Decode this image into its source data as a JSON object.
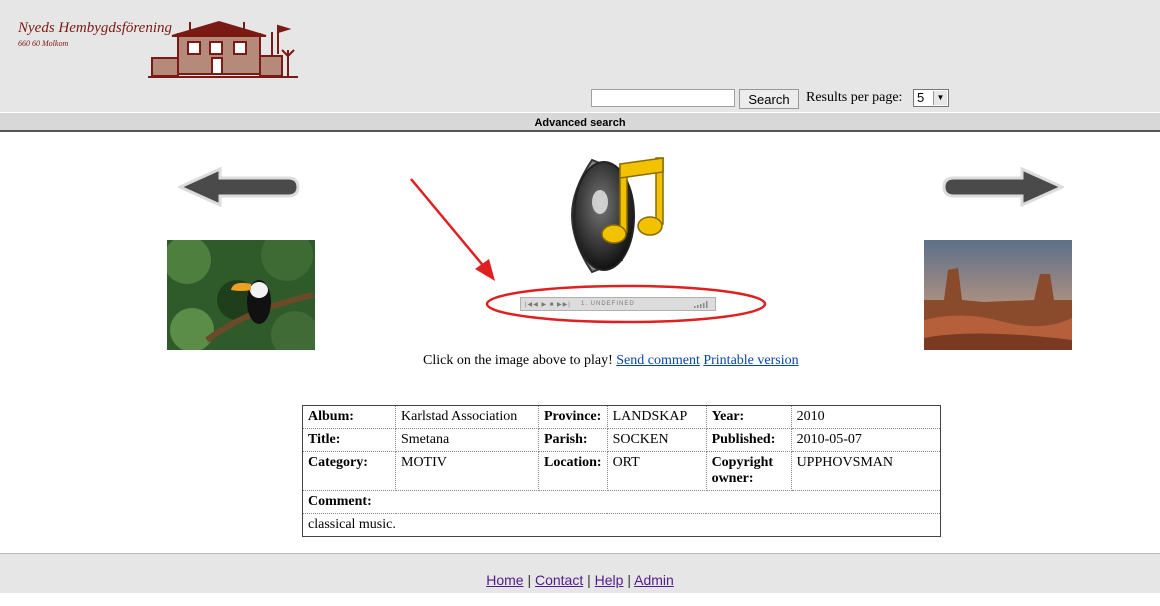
{
  "logo": {
    "name": "Nyeds Hembygdsförening",
    "address": "660 60 Molkom"
  },
  "search": {
    "button_label": "Search",
    "results_label": "Results per page:",
    "results_value": "5"
  },
  "advanced_search": "Advanced search",
  "player": {
    "track": "1. UNDEFINED"
  },
  "instructions": {
    "text": "Click on the image above to play!",
    "send_comment": "Send comment",
    "printable": "Printable version"
  },
  "details": {
    "album_label": "Album:",
    "album": "Karlstad Association",
    "province_label": "Province:",
    "province": "LANDSKAP",
    "year_label": "Year:",
    "year": "2010",
    "title_label": "Title:",
    "title": "Smetana",
    "parish_label": "Parish:",
    "parish": "SOCKEN",
    "published_label": "Published:",
    "published": "2010-05-07",
    "category_label": "Category:",
    "category": "MOTIV",
    "location_label": "Location:",
    "location": "ORT",
    "copyright_label": "Copyright owner:",
    "copyright": "UPPHOVSMAN",
    "comment_label": "Comment:",
    "comment": "classical music."
  },
  "footer": {
    "home": "Home",
    "contact": "Contact",
    "help": "Help",
    "admin": "Admin",
    "sep": "|"
  },
  "colors": {
    "header_bg": "#e6e6e6",
    "logo": "#7a1a14",
    "link": "#0645ad",
    "annotation": "#e02020"
  }
}
